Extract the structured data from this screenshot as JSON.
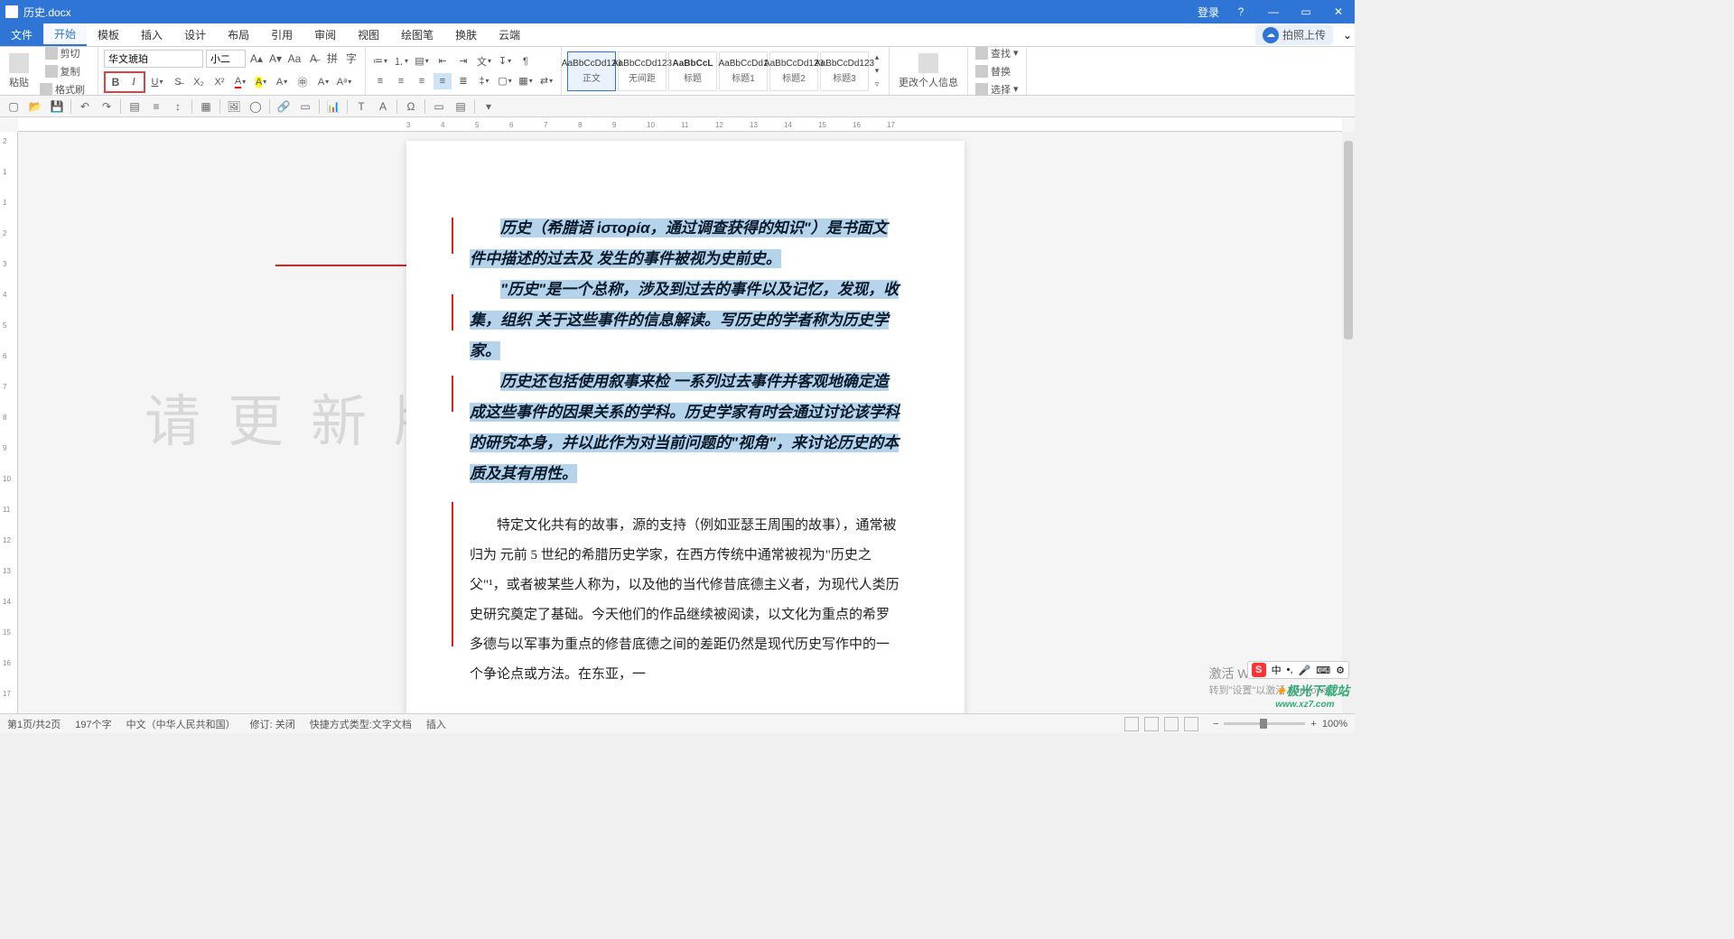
{
  "title": "历史.docx",
  "window": {
    "login": "登录"
  },
  "menu": {
    "items": [
      "文件",
      "开始",
      "模板",
      "插入",
      "设计",
      "布局",
      "引用",
      "审阅",
      "视图",
      "绘图笔",
      "换肤",
      "云端"
    ],
    "active": 1,
    "upload": "拍照上传"
  },
  "ribbon": {
    "paste": "粘贴",
    "cut": "剪切",
    "copy": "复制",
    "format_painter": "格式刷",
    "font_name": "华文琥珀",
    "font_size": "小二",
    "modify_info": "更改个人信息",
    "find": "查找",
    "replace": "替换",
    "select": "选择",
    "styles": [
      {
        "preview": "AaBbCcDd123",
        "label": "正文"
      },
      {
        "preview": "AaBbCcDd123",
        "label": "无间距"
      },
      {
        "preview": "AaBbCcL",
        "label": "标题"
      },
      {
        "preview": "AaBbCcDd1",
        "label": "标题1"
      },
      {
        "preview": "AaBbCcDd123",
        "label": "标题2"
      },
      {
        "preview": "AaBbCcDd123",
        "label": "标题3"
      }
    ]
  },
  "document": {
    "watermark": "请更新版本",
    "para1": "历史（希腊语 ἱστορία，通过调查获得的知识\"）是书面文件中描述的过去及 发生的事件被视为史前史。",
    "para2": "\"历史\"是一个总称，涉及到过去的事件以及记忆，发现，收集，组织 关于这些事件的信息解读。写历史的学者称为历史学家。",
    "para3": "历史还包括使用叙事来检 一系列过去事件并客观地确定造成这些事件的因果关系的学科。历史学家有时会通过讨论该学科的研究本身，并以此作为对当前问题的\"视角\"，来讨论历史的本质及其有用性。",
    "para4": "特定文化共有的故事，源的支持（例如亚瑟王周围的故事），通常被归为 元前 5 世纪的希腊历史学家，在西方传统中通常被视为\"历史之父\"¹，或者被某些人称为，以及他的当代修昔底德主义者，为现代人类历史研究奠定了基础。今天他们的作品继续被阅读，以文化为重点的希罗多德与以军事为重点的修昔底德之间的差距仍然是现代历史写作中的一个争论点或方法。在东亚，一"
  },
  "status": {
    "page": "第1页/共2页",
    "words": "197个字",
    "lang": "中文（中华人民共和国）",
    "revision": "修订: 关闭",
    "shortcut": "快捷方式类型:文字文档",
    "mode": "插入",
    "zoom": "100%"
  },
  "activate": {
    "title": "激活 Windows",
    "sub": "转到\"设置\"以激活 Windows。"
  },
  "brand": {
    "name": "极光下载站",
    "url": "www.xz7.com"
  },
  "ruler_h": [
    3,
    4,
    5,
    6,
    7,
    8,
    9,
    10,
    11,
    12,
    13,
    14,
    15,
    16,
    17
  ],
  "ruler_v": [
    2,
    1,
    1,
    2,
    3,
    4,
    5,
    6,
    7,
    8,
    9,
    10,
    11,
    12,
    13,
    14,
    15,
    16,
    17
  ]
}
